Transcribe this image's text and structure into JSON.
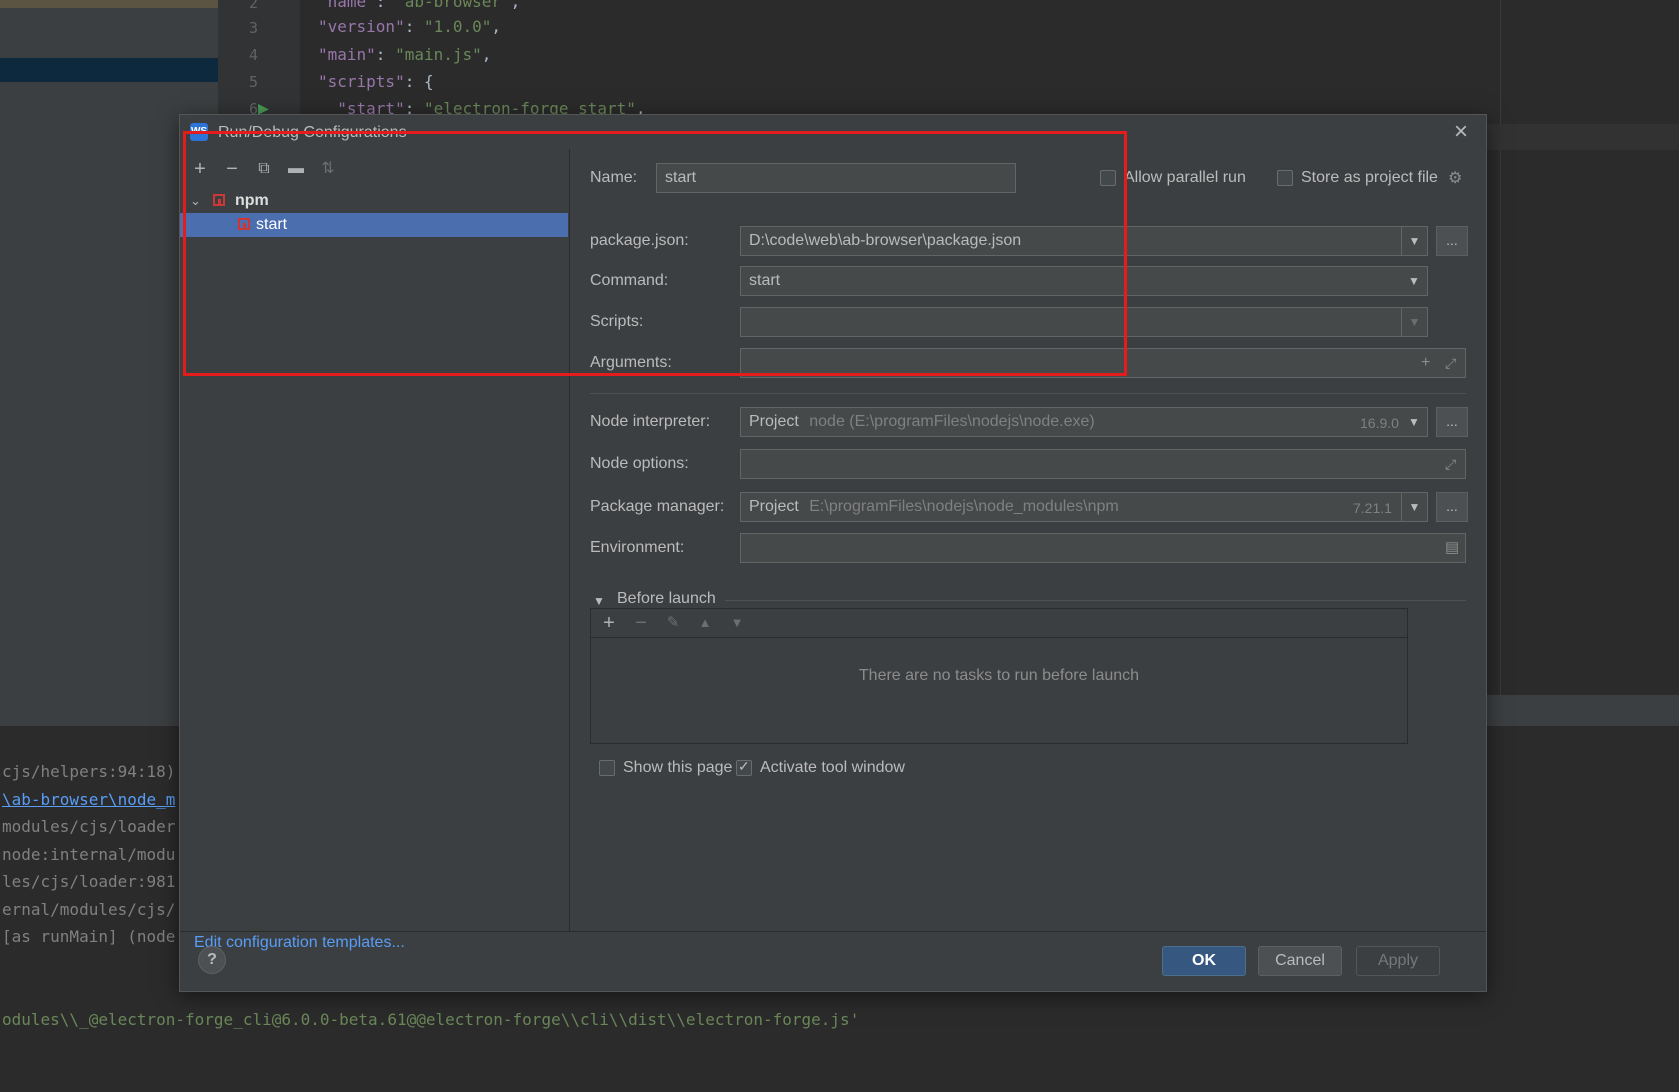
{
  "editor": {
    "lines": [
      {
        "num": "2",
        "text": "\"name\": \"ab-browser\","
      },
      {
        "num": "3",
        "text": "\"version\": \"1.0.0\","
      },
      {
        "num": "4",
        "text": "\"main\": \"main.js\","
      },
      {
        "num": "5",
        "text": "\"scripts\": {"
      },
      {
        "num": "6",
        "text": "  \"start\": \"electron-forge start\","
      }
    ]
  },
  "console": {
    "lines": [
      "cjs/helpers:94:18)",
      "\\ab-browser\\node_m",
      "modules/cjs/loader",
      "node:internal/modu",
      "les/cjs/loader:981",
      "ernal/modules/cjs/",
      "[as runMain] (node",
      "odules\\\\_@electron-forge_cli@6.0.0-beta.61@@electron-forge\\\\cli\\\\dist\\\\electron-forge.js'"
    ]
  },
  "dialog": {
    "title": "Run/Debug Configurations",
    "close_icon": "×",
    "tree": {
      "group": "npm",
      "item": "start"
    },
    "edit_templates": "Edit configuration templates...",
    "form": {
      "name_label": "Name:",
      "name_value": "start",
      "allow_parallel": "Allow parallel run",
      "store_project": "Store as project file",
      "package_json_label": "package.json:",
      "package_json_value": "D:\\code\\web\\ab-browser\\package.json",
      "command_label": "Command:",
      "command_value": "start",
      "scripts_label": "Scripts:",
      "scripts_value": "",
      "arguments_label": "Arguments:",
      "node_interpreter_label": "Node interpreter:",
      "node_interpreter_prefix": "Project",
      "node_interpreter_value": "node (E:\\programFiles\\nodejs\\node.exe)",
      "node_version": "16.9.0",
      "node_options_label": "Node options:",
      "package_manager_label": "Package manager:",
      "package_manager_prefix": "Project",
      "package_manager_value": "E:\\programFiles\\nodejs\\node_modules\\npm",
      "package_manager_version": "7.21.1",
      "environment_label": "Environment:",
      "dots": "...",
      "before_launch": "Before launch",
      "no_tasks": "There are no tasks to run before launch",
      "show_page": "Show this page",
      "activate_tool": "Activate tool window"
    },
    "buttons": {
      "ok": "OK",
      "cancel": "Cancel",
      "apply": "Apply",
      "help": "?"
    }
  },
  "checkboxes": {
    "allow_parallel": false,
    "store_project": false,
    "show_page": false,
    "activate_tool": true
  },
  "colors": {
    "accent_selection": "#4b6eaf",
    "annotation_red": "#e51c1c",
    "link": "#589df6"
  }
}
